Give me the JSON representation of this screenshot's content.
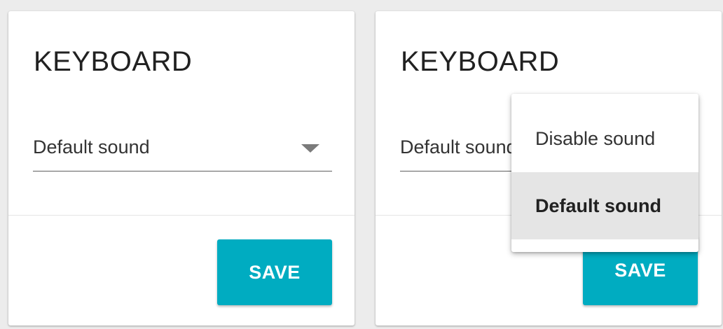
{
  "left_card": {
    "title": "KEYBOARD",
    "select_value": "Default sound",
    "save_label": "SAVE"
  },
  "right_card": {
    "title": "KEYBOARD",
    "select_value": "Default sound",
    "save_label": "SAVE"
  },
  "dropdown_menu": {
    "options": [
      {
        "label": "Disable sound",
        "selected": false
      },
      {
        "label": "Default sound",
        "selected": true
      }
    ]
  },
  "colors": {
    "accent": "#00acc1",
    "background": "#ececec",
    "card": "#ffffff",
    "selected_option_bg": "#e5e5e5"
  },
  "icons": {
    "select_caret": "caret-down-icon"
  }
}
